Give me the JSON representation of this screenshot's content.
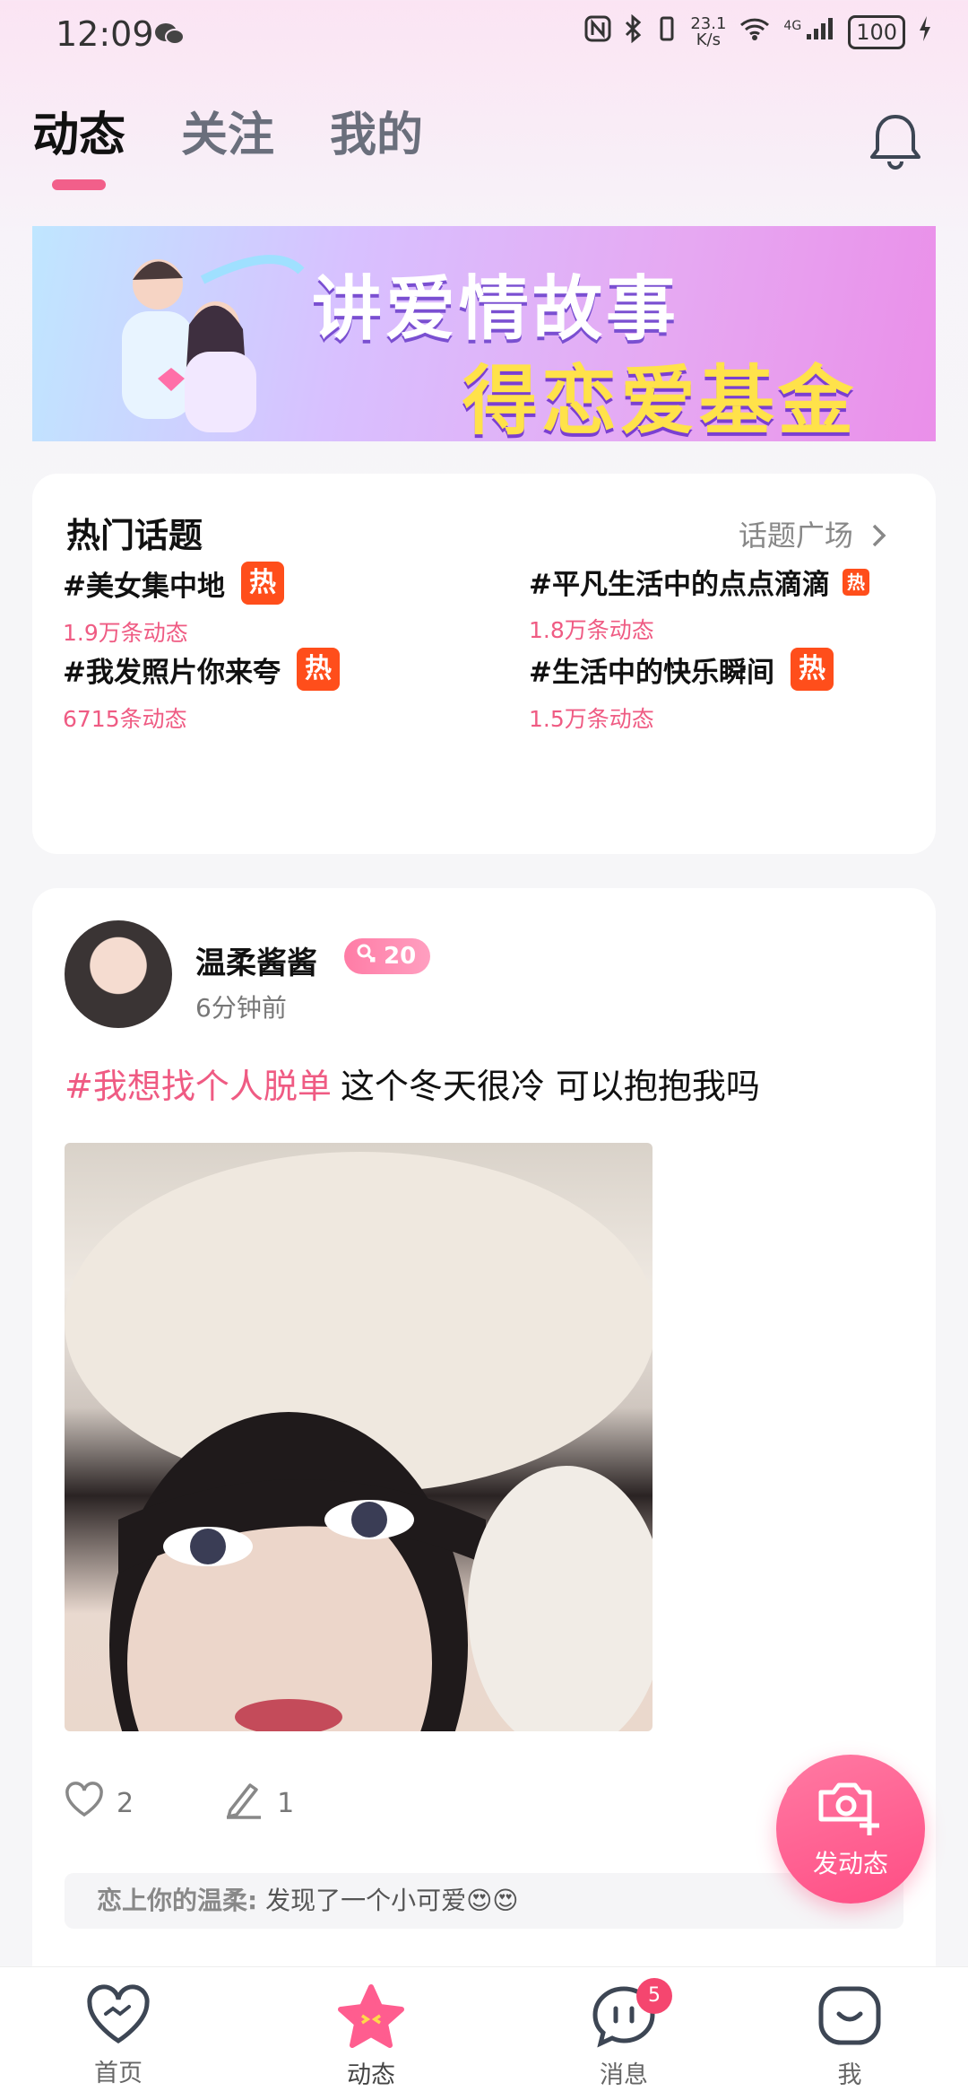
{
  "status_bar": {
    "time": "12:09",
    "network_speed": "23.1",
    "network_speed_unit": "K/s",
    "network_type": "4G",
    "battery": "100"
  },
  "header": {
    "tabs": [
      {
        "label": "动态",
        "active": true
      },
      {
        "label": "关注",
        "active": false
      },
      {
        "label": "我的",
        "active": false
      }
    ]
  },
  "banner": {
    "line1": "讲爱情故事",
    "line2": "得恋爱基金"
  },
  "hot_topics": {
    "title": "热门话题",
    "more_label": "话题广场",
    "hot_badge": "热",
    "items": [
      {
        "name": "#美女集中地",
        "count": "1.9万条动态"
      },
      {
        "name": "#平凡生活中的点点滴滴",
        "count": "1.8万条动态"
      },
      {
        "name": "#我发照片你来夸",
        "count": "6715条动态"
      },
      {
        "name": "#生活中的快乐瞬间",
        "count": "1.5万条动态"
      }
    ]
  },
  "post": {
    "username": "温柔酱酱",
    "level": "20",
    "time": "6分钟前",
    "tag": "#我想找个人脱单",
    "text": "这个冬天很冷 可以抱抱我吗",
    "likes": "2",
    "comments": "1",
    "comment_preview": {
      "author": "恋上你的温柔:",
      "text": "发现了一个小可爱😍😍"
    }
  },
  "fab": {
    "label": "发动态"
  },
  "bottom_nav": {
    "items": [
      {
        "label": "首页"
      },
      {
        "label": "动态"
      },
      {
        "label": "消息",
        "badge": "5"
      },
      {
        "label": "我"
      }
    ]
  },
  "colors": {
    "accent": "#f25f8a",
    "hot_badge": "#ff4e1b",
    "topic_count": "#ef5b83"
  }
}
